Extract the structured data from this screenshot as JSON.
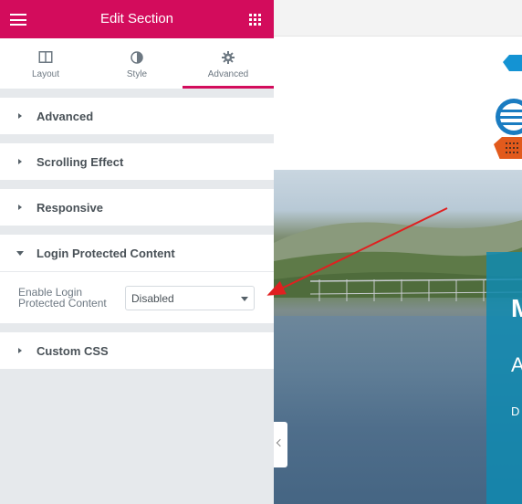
{
  "header": {
    "title": "Edit Section"
  },
  "tabs": [
    {
      "label": "Layout",
      "icon": "columns-icon",
      "active": false
    },
    {
      "label": "Style",
      "icon": "half-circle-icon",
      "active": false
    },
    {
      "label": "Advanced",
      "icon": "gear-icon",
      "active": true
    }
  ],
  "sections": {
    "advanced": {
      "label": "Advanced",
      "expanded": false
    },
    "scrolling": {
      "label": "Scrolling Effect",
      "expanded": false
    },
    "responsive": {
      "label": "Responsive",
      "expanded": false
    },
    "login": {
      "label": "Login Protected Content",
      "expanded": true,
      "field_label": "Enable Login Protected Content",
      "select_value": "Disabled"
    },
    "custom_css": {
      "label": "Custom CSS",
      "expanded": false
    }
  },
  "preview": {
    "overlay_h1": "M",
    "overlay_h2": "A",
    "overlay_p": "D"
  },
  "colors": {
    "brand": "#d30c5c",
    "panel_bg": "#e6e9ec",
    "overlay": "#0f8ab0",
    "annotation_arrow": "#e02020"
  }
}
